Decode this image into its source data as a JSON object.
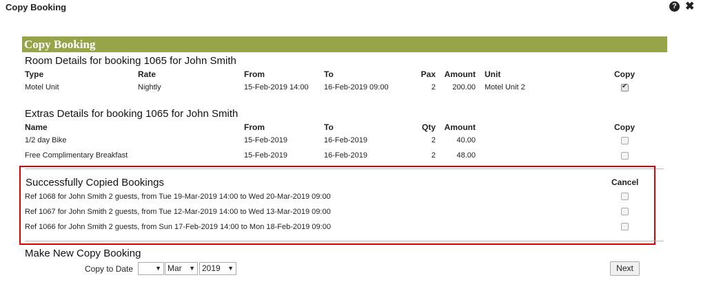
{
  "dialog": {
    "title": "Copy Booking",
    "help_icon": "question-circle-icon",
    "close_icon": "close-icon",
    "help_glyph": "?",
    "close_glyph": "✖"
  },
  "banner": {
    "title": "Copy Booking"
  },
  "room": {
    "title": "Room Details for booking 1065 for John Smith",
    "headers": {
      "type": "Type",
      "rate": "Rate",
      "from": "From",
      "to": "To",
      "pax": "Pax",
      "amount": "Amount",
      "unit": "Unit",
      "copy": "Copy"
    },
    "rows": [
      {
        "type": "Motel Unit",
        "rate": "Nightly",
        "from": "15-Feb-2019 14:00",
        "to": "16-Feb-2019 09:00",
        "pax": "2",
        "amount": "200.00",
        "unit": "Motel Unit 2",
        "copy": true
      }
    ]
  },
  "extras": {
    "title": "Extras Details for booking 1065 for John Smith",
    "headers": {
      "name": "Name",
      "from": "From",
      "to": "To",
      "qty": "Qty",
      "amount": "Amount",
      "copy": "Copy"
    },
    "rows": [
      {
        "name": "1/2 day Bike",
        "from": "15-Feb-2019",
        "to": "16-Feb-2019",
        "qty": "2",
        "amount": "40.00",
        "copy": false
      },
      {
        "name": "Free Complimentary Breakfast",
        "from": "15-Feb-2019",
        "to": "16-Feb-2019",
        "qty": "2",
        "amount": "48.00",
        "copy": false
      }
    ]
  },
  "copied": {
    "title": "Successfully Copied Bookings",
    "cancel_header": "Cancel",
    "rows": [
      {
        "text": "Ref 1068 for John Smith 2 guests, from Tue 19-Mar-2019 14:00 to Wed 20-Mar-2019 09:00",
        "cancel": false
      },
      {
        "text": "Ref 1067 for John Smith 2 guests, from Tue 12-Mar-2019 14:00 to Wed 13-Mar-2019 09:00",
        "cancel": false
      },
      {
        "text": "Ref 1066 for John Smith 2 guests, from Sun 17-Feb-2019 14:00 to Mon 18-Feb-2019 09:00",
        "cancel": false
      }
    ]
  },
  "new_copy": {
    "title": "Make New Copy Booking",
    "date_label": "Copy to Date",
    "day_value": "",
    "month_value": "Mar",
    "year_value": "2019",
    "next_label": "Next"
  },
  "colors": {
    "banner": "#97a447",
    "highlight_border": "#e00000"
  }
}
